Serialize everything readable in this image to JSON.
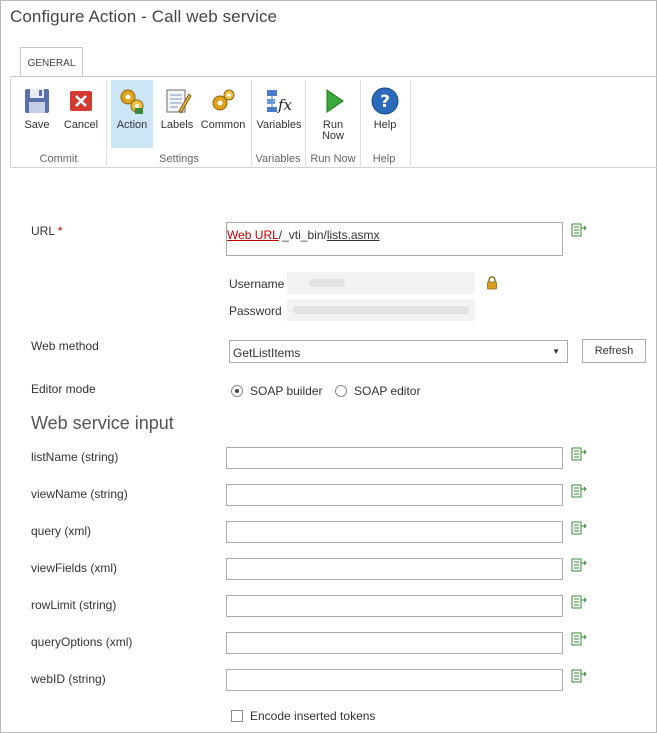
{
  "window": {
    "title": "Configure Action - Call web service"
  },
  "ribbon": {
    "tab": "GENERAL",
    "groups": {
      "commit": "Commit",
      "settings": "Settings",
      "variables": "Variables",
      "run_now": "Run Now",
      "help": "Help"
    },
    "buttons": {
      "save": "Save",
      "cancel": "Cancel",
      "action": "Action",
      "labels": "Labels",
      "common": "Common",
      "variables": "Variables",
      "run_now_line1": "Run",
      "run_now_line2": "Now",
      "help": "Help"
    },
    "icons": {
      "save": "floppy-disk-icon",
      "cancel": "red-x-icon",
      "action": "gears-icon",
      "labels": "notepad-pencil-icon",
      "common": "gears-gold-icon",
      "variables": "fx-variables-icon",
      "run_now": "green-play-icon",
      "help": "help-question-icon"
    }
  },
  "form": {
    "url": {
      "label": "URL",
      "required_mark": "*",
      "token": "Web URL",
      "path_part1": "/_vti_bin/",
      "path_part2": "lists.asmx"
    },
    "credentials": {
      "username_label": "Username",
      "password_label": "Password"
    },
    "web_method": {
      "label": "Web method",
      "selected": "GetListItems",
      "refresh_label": "Refresh"
    },
    "editor_mode": {
      "label": "Editor mode",
      "options": [
        "SOAP builder",
        "SOAP editor"
      ],
      "selected": "SOAP builder"
    },
    "section_title": "Web service input",
    "inputs": [
      {
        "label": "listName (string)",
        "value": ""
      },
      {
        "label": "viewName (string)",
        "value": ""
      },
      {
        "label": "query (xml)",
        "value": ""
      },
      {
        "label": "viewFields (xml)",
        "value": ""
      },
      {
        "label": "rowLimit (string)",
        "value": ""
      },
      {
        "label": "queryOptions (xml)",
        "value": ""
      },
      {
        "label": "webID (string)",
        "value": ""
      }
    ],
    "encode_tokens_label": "Encode inserted tokens"
  },
  "colors": {
    "accent_active": "#cde6f7",
    "required": "#cc0000",
    "token": "#c00000"
  }
}
